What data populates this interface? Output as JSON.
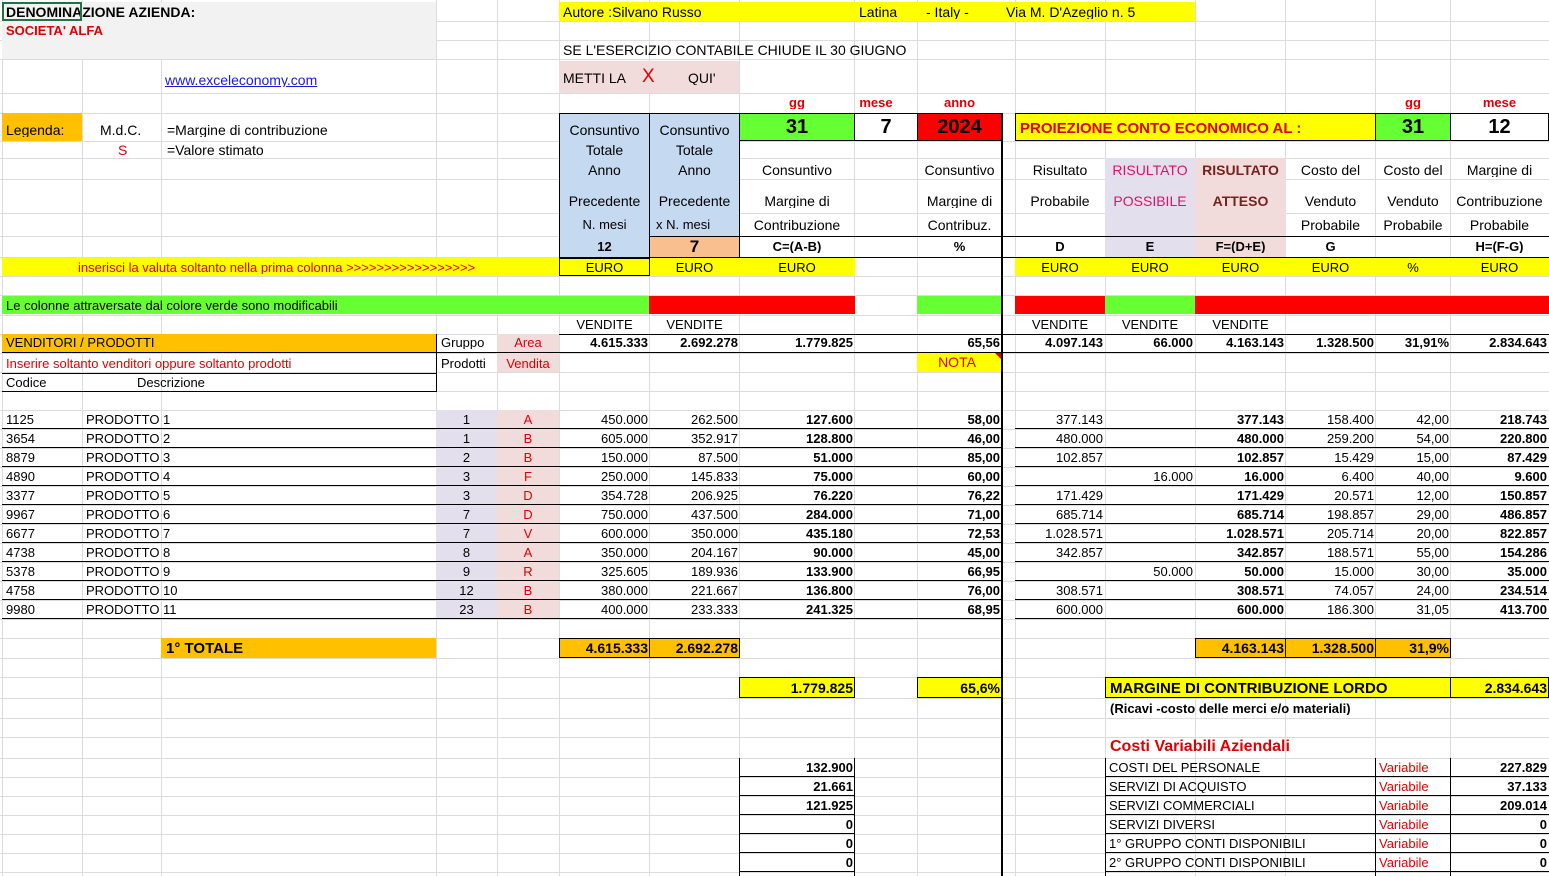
{
  "colors": {
    "yellow": "#ffff00",
    "orange": "#ffc000",
    "green": "#66ff33",
    "red": "#ff0000",
    "lightblue": "#c5d9f1",
    "peach": "#fabf8f",
    "lavender": "#e4dfec",
    "pinkbg": "#f2dcdb",
    "grey": "#f2f2f2"
  },
  "header": {
    "company_label": "DENOMINAZIONE AZIENDA:",
    "company_name": "SOCIETA' ALFA",
    "website": "www.exceleconomy.com",
    "author": "Autore :Silvano Russo",
    "city": "Latina",
    "country": "- Italy -",
    "address": "Via M. D'Azeglio n. 5",
    "fiscal_note": "SE L'ESERCIZIO CONTABILE CHIUDE  IL 30 GIUGNO",
    "metti_la": "METTI  LA",
    "x_mark": "X",
    "qui": "QUI'"
  },
  "legend": {
    "label": "Legenda:",
    "mdc_abbr": "M.d.C.",
    "mdc_desc": "=Margine di contribuzione",
    "s_abbr": "S",
    "s_desc": "=Valore stimato"
  },
  "date_left": {
    "gg_label": "gg",
    "mese_label": "mese",
    "anno_label": "anno",
    "gg": "31",
    "mese": "7",
    "anno": "2024"
  },
  "projection": {
    "title": "PROIEZIONE CONTO ECONOMICO AL :",
    "gg_label": "gg",
    "mese_label": "mese",
    "gg": "31",
    "mese": "12"
  },
  "col_headers": {
    "a": [
      "Consuntivo",
      "Totale",
      "Anno",
      "Precedente",
      "N. mesi"
    ],
    "a_months": "12",
    "b": [
      "Consuntivo",
      "Totale",
      "Anno",
      "Precedente",
      "x N. mesi"
    ],
    "b_months": "7",
    "c": [
      "Consuntivo",
      "Margine di",
      "Contribuzione"
    ],
    "c_formula": "C=(A-B)",
    "pct": [
      "Consuntivo",
      "Margine di",
      "Contribuz."
    ],
    "pct_formula": "%",
    "d": [
      "Risultato",
      "Probabile"
    ],
    "d_formula": "D",
    "e": [
      "RISULTATO",
      "POSSIBILE"
    ],
    "e_formula": "E",
    "f": [
      "RISULTATO",
      "ATTESO"
    ],
    "f_formula": "F=(D+E)",
    "g": [
      "Costo del",
      "Venduto",
      "Probabile"
    ],
    "g_formula": "G",
    "gp": [
      "Costo del",
      "Venduto",
      "Probabile"
    ],
    "h": [
      "Margine di",
      "Contribuzione",
      "Probabile"
    ],
    "h_formula": "H=(F-G)"
  },
  "currency_row": {
    "note": "inserisci la valuta soltanto nella prima colonna >>>>>>>>>>>>>>>>>",
    "euro": "EURO",
    "pct": "%"
  },
  "green_note": "Le colonne attraversate dal colore verde sono modificabili",
  "vendite_label": "VENDITE",
  "section": {
    "title": "VENDITORI / PRODOTTI",
    "gruppo": "Gruppo",
    "prodotti": "Prodotti",
    "area": "Area",
    "vendita": "Vendita",
    "instruction": "Inserire soltanto venditori oppure soltanto prodotti",
    "codice": "Codice",
    "descrizione": "Descrizione",
    "nota": "NOTA"
  },
  "summary_row": {
    "a": "4.615.333",
    "b": "2.692.278",
    "c": "1.779.825",
    "pct": "65,56",
    "d": "4.097.143",
    "e": "66.000",
    "f": "4.163.143",
    "g": "1.328.500",
    "gp": "31,91%",
    "h": "2.834.643"
  },
  "rows": [
    {
      "code": "1125",
      "desc": "PRODOTTO 1",
      "grp": "1",
      "area": "A",
      "a": "450.000",
      "b": "262.500",
      "c": "127.600",
      "pct": "58,00",
      "d": "377.143",
      "e": "",
      "f": "377.143",
      "g": "158.400",
      "gp": "42,00",
      "h": "218.743"
    },
    {
      "code": "3654",
      "desc": "PRODOTTO 2",
      "grp": "1",
      "area": "B",
      "a": "605.000",
      "b": "352.917",
      "c": "128.800",
      "pct": "46,00",
      "d": "480.000",
      "e": "",
      "f": "480.000",
      "g": "259.200",
      "gp": "54,00",
      "h": "220.800"
    },
    {
      "code": "8879",
      "desc": "PRODOTTO 3",
      "grp": "2",
      "area": "B",
      "a": "150.000",
      "b": "87.500",
      "c": "51.000",
      "pct": "85,00",
      "d": "102.857",
      "e": "",
      "f": "102.857",
      "g": "15.429",
      "gp": "15,00",
      "h": "87.429"
    },
    {
      "code": "4890",
      "desc": "PRODOTTO 4",
      "grp": "3",
      "area": "F",
      "a": "250.000",
      "b": "145.833",
      "c": "75.000",
      "pct": "60,00",
      "d": "",
      "e": "16.000",
      "f": "16.000",
      "g": "6.400",
      "gp": "40,00",
      "h": "9.600"
    },
    {
      "code": "3377",
      "desc": "PRODOTTO 5",
      "grp": "3",
      "area": "D",
      "a": "354.728",
      "b": "206.925",
      "c": "76.220",
      "pct": "76,22",
      "d": "171.429",
      "e": "",
      "f": "171.429",
      "g": "20.571",
      "gp": "12,00",
      "h": "150.857"
    },
    {
      "code": "9967",
      "desc": "PRODOTTO 6",
      "grp": "7",
      "area": "D",
      "a": "750.000",
      "b": "437.500",
      "c": "284.000",
      "pct": "71,00",
      "d": "685.714",
      "e": "",
      "f": "685.714",
      "g": "198.857",
      "gp": "29,00",
      "h": "486.857"
    },
    {
      "code": "6677",
      "desc": "PRODOTTO 7",
      "grp": "7",
      "area": "V",
      "a": "600.000",
      "b": "350.000",
      "c": "435.180",
      "pct": "72,53",
      "d": "1.028.571",
      "e": "",
      "f": "1.028.571",
      "g": "205.714",
      "gp": "20,00",
      "h": "822.857"
    },
    {
      "code": "4738",
      "desc": "PRODOTTO 8",
      "grp": "8",
      "area": "A",
      "a": "350.000",
      "b": "204.167",
      "c": "90.000",
      "pct": "45,00",
      "d": "342.857",
      "e": "",
      "f": "342.857",
      "g": "188.571",
      "gp": "55,00",
      "h": "154.286"
    },
    {
      "code": "5378",
      "desc": "PRODOTTO 9",
      "grp": "9",
      "area": "R",
      "a": "325.605",
      "b": "189.936",
      "c": "133.900",
      "pct": "66,95",
      "d": "",
      "e": "50.000",
      "f": "50.000",
      "g": "15.000",
      "gp": "30,00",
      "h": "35.000"
    },
    {
      "code": "4758",
      "desc": "PRODOTTO 10",
      "grp": "12",
      "area": "B",
      "a": "380.000",
      "b": "221.667",
      "c": "136.800",
      "pct": "76,00",
      "d": "308.571",
      "e": "",
      "f": "308.571",
      "g": "74.057",
      "gp": "24,00",
      "h": "234.514"
    },
    {
      "code": "9980",
      "desc": "PRODOTTO 11",
      "grp": "23",
      "area": "B",
      "a": "400.000",
      "b": "233.333",
      "c": "241.325",
      "pct": "68,95",
      "d": "600.000",
      "e": "",
      "f": "600.000",
      "g": "186.300",
      "gp": "31,05",
      "h": "413.700"
    }
  ],
  "totals": {
    "label": "1° TOTALE",
    "a": "4.615.333",
    "b": "2.692.278",
    "f": "4.163.143",
    "g": "1.328.500",
    "gp": "31,9%"
  },
  "margin": {
    "c": "1.779.825",
    "pct": "65,6%",
    "title": "MARGINE DI CONTRIBUZIONE LORDO",
    "value": "2.834.643",
    "note": "(Ricavi -costo delle merci e/o materiali)"
  },
  "costs": {
    "title": "Costi Variabili Aziendali",
    "left_values": [
      "132.900",
      "21.661",
      "121.925",
      "0",
      "0",
      "0"
    ],
    "items": [
      {
        "name": "COSTI DEL PERSONALE",
        "type": "Variabile",
        "value": "227.829"
      },
      {
        "name": "SERVIZI DI ACQUISTO",
        "type": "Variabile",
        "value": "37.133"
      },
      {
        "name": "SERVIZI COMMERCIALI",
        "type": "Variabile",
        "value": "209.014"
      },
      {
        "name": "SERVIZI DIVERSI",
        "type": "Variabile",
        "value": "0"
      },
      {
        "name": "1° GRUPPO CONTI DISPONIBILI",
        "type": "Variabile",
        "value": "0"
      },
      {
        "name": "2° GRUPPO CONTI DISPONIBILI",
        "type": "Variabile",
        "value": "0"
      }
    ]
  }
}
